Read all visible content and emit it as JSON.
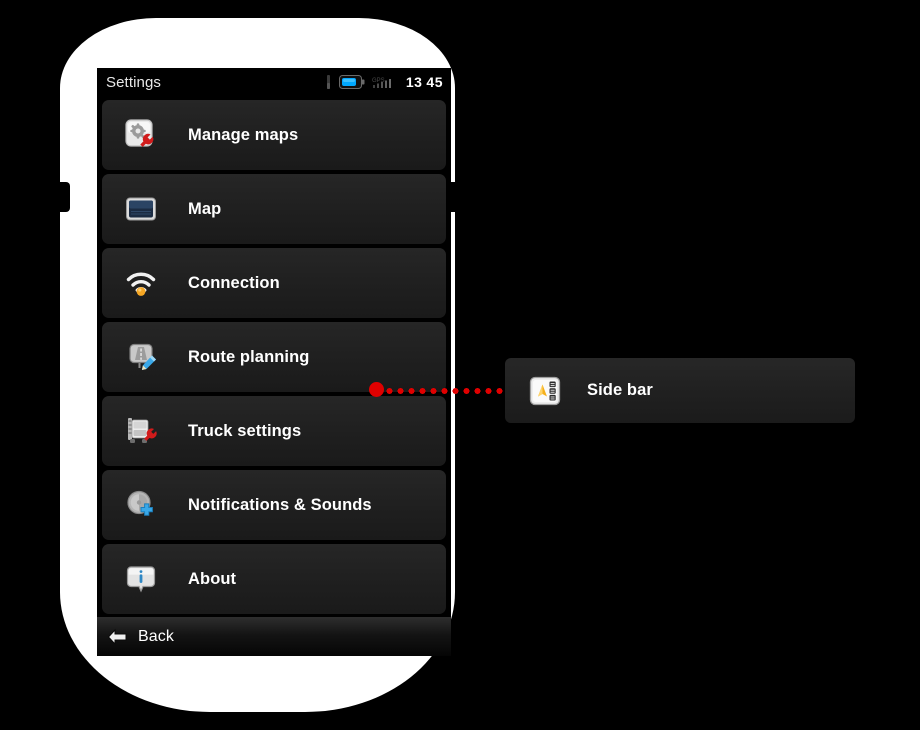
{
  "device": {
    "name": "handheld-navigation-device"
  },
  "statusbar": {
    "title": "Settings",
    "time_hours": "13",
    "time_minutes": "45",
    "icons": [
      "signal-bar-icon",
      "battery-icon",
      "gps-signal-icon"
    ]
  },
  "settings_list": {
    "items": [
      {
        "label": "Manage maps",
        "icon": "manage-maps-icon"
      },
      {
        "label": "Map",
        "icon": "map-screen-icon"
      },
      {
        "label": "Connection",
        "icon": "wifi-connection-icon"
      },
      {
        "label": "Route planning",
        "icon": "route-planning-icon"
      },
      {
        "label": "Truck settings",
        "icon": "truck-settings-icon"
      },
      {
        "label": "Notifications & Sounds",
        "icon": "notifications-sounds-icon"
      },
      {
        "label": "About",
        "icon": "about-info-icon"
      }
    ]
  },
  "backbar": {
    "label": "Back",
    "icon": "back-arrow-icon"
  },
  "callout": {
    "label": "Side bar",
    "icon": "side-bar-icon",
    "connector_color": "#e00000"
  },
  "colors": {
    "device_body": "#ffffff",
    "screen_bg": "#000000",
    "row_bg": "#222222",
    "accent_red": "#e00000",
    "accent_blue": "#2f9fe0",
    "accent_orange": "#f5a623"
  }
}
